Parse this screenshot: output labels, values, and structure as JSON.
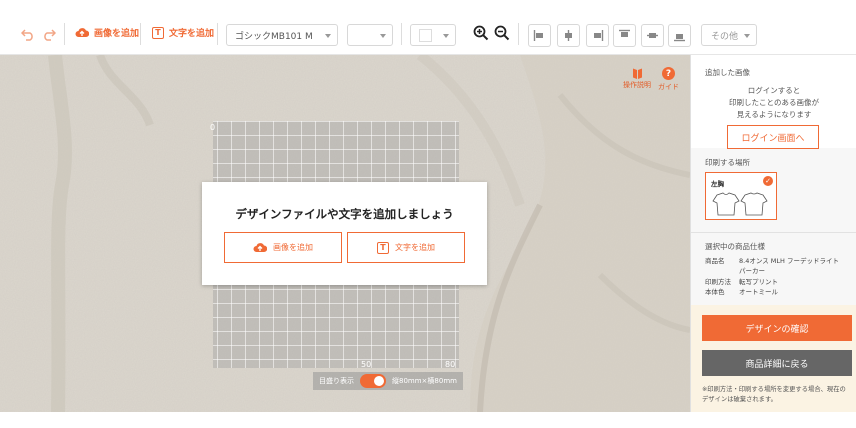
{
  "toolbar": {
    "add_image_label": "画像を追加",
    "add_text_label": "文字を追加",
    "font_value": "ゴシックMB101 M",
    "size_value": "",
    "color_value": "",
    "other_label": "その他"
  },
  "canvas": {
    "guide_icons": [
      {
        "label": "操作説明",
        "icon": "book-icon"
      },
      {
        "label": "ガイド",
        "icon": "question-icon"
      }
    ],
    "ruler": {
      "top_left": "0",
      "bottom_mid": "50",
      "bottom_right": "80"
    },
    "toggle_label": "目盛り表示",
    "size_text": "縦80mm×横80mm",
    "modal": {
      "title": "デザインファイルや文字を追加しましょう",
      "add_image": "画像を追加",
      "add_text": "文字を追加"
    }
  },
  "panel": {
    "added_images_title": "追加した画像",
    "login_message": [
      "ログインすると",
      "印刷したことのある画像が",
      "見えるようになります"
    ],
    "login_button": "ログイン画面へ",
    "print_place_title": "印刷する場所",
    "print_place_selected": "左胸",
    "spec_title": "選択中の商品仕様",
    "specs": [
      {
        "key": "商品名",
        "value": "8.4オンス MLH フーデッドライトパーカー"
      },
      {
        "key": "印刷方法",
        "value": "転写プリント"
      },
      {
        "key": "本体色",
        "value": "オートミール"
      }
    ],
    "confirm_button": "デザインの確認",
    "back_button": "商品詳細に戻る",
    "note": "※印刷方法・印刷する場所を変更する場合、現在のデザインは破棄されます。"
  },
  "colors": {
    "accent": "#f06a35",
    "gray_button": "#666666"
  }
}
